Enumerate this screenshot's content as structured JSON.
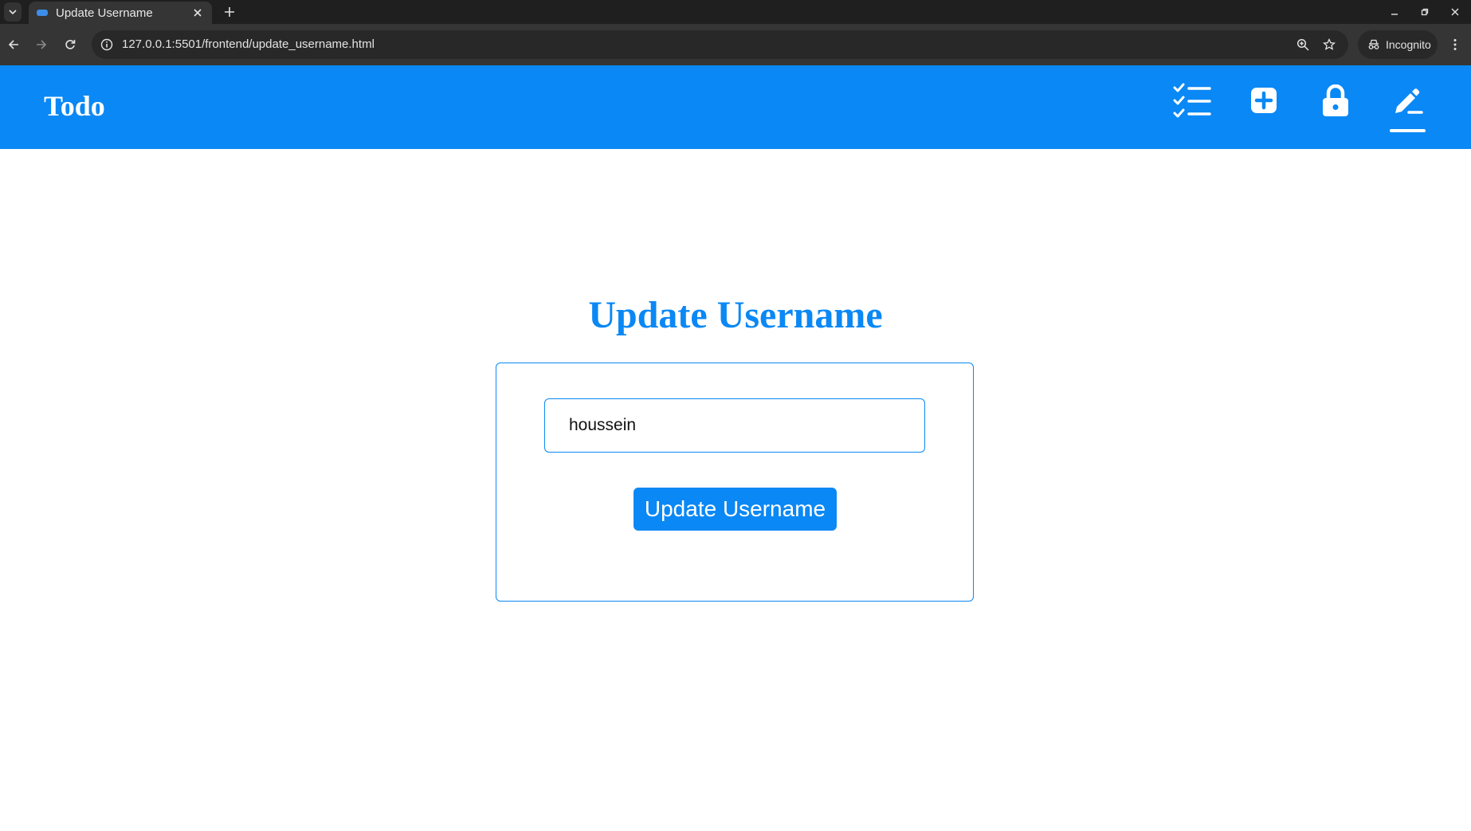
{
  "browser": {
    "tab_title": "Update Username",
    "url": "127.0.0.1:5501/frontend/update_username.html",
    "incognito_label": "Incognito"
  },
  "nav": {
    "brand": "Todo",
    "icons": [
      "checklist-icon",
      "add-square-icon",
      "lock-icon",
      "pen-icon"
    ],
    "active_item": "pen-icon"
  },
  "main": {
    "title": "Update Username",
    "username_value": "houssein",
    "submit_label": "Update Username"
  },
  "colors": {
    "primary": "#0a88f5",
    "nav_text": "#ffffff"
  }
}
